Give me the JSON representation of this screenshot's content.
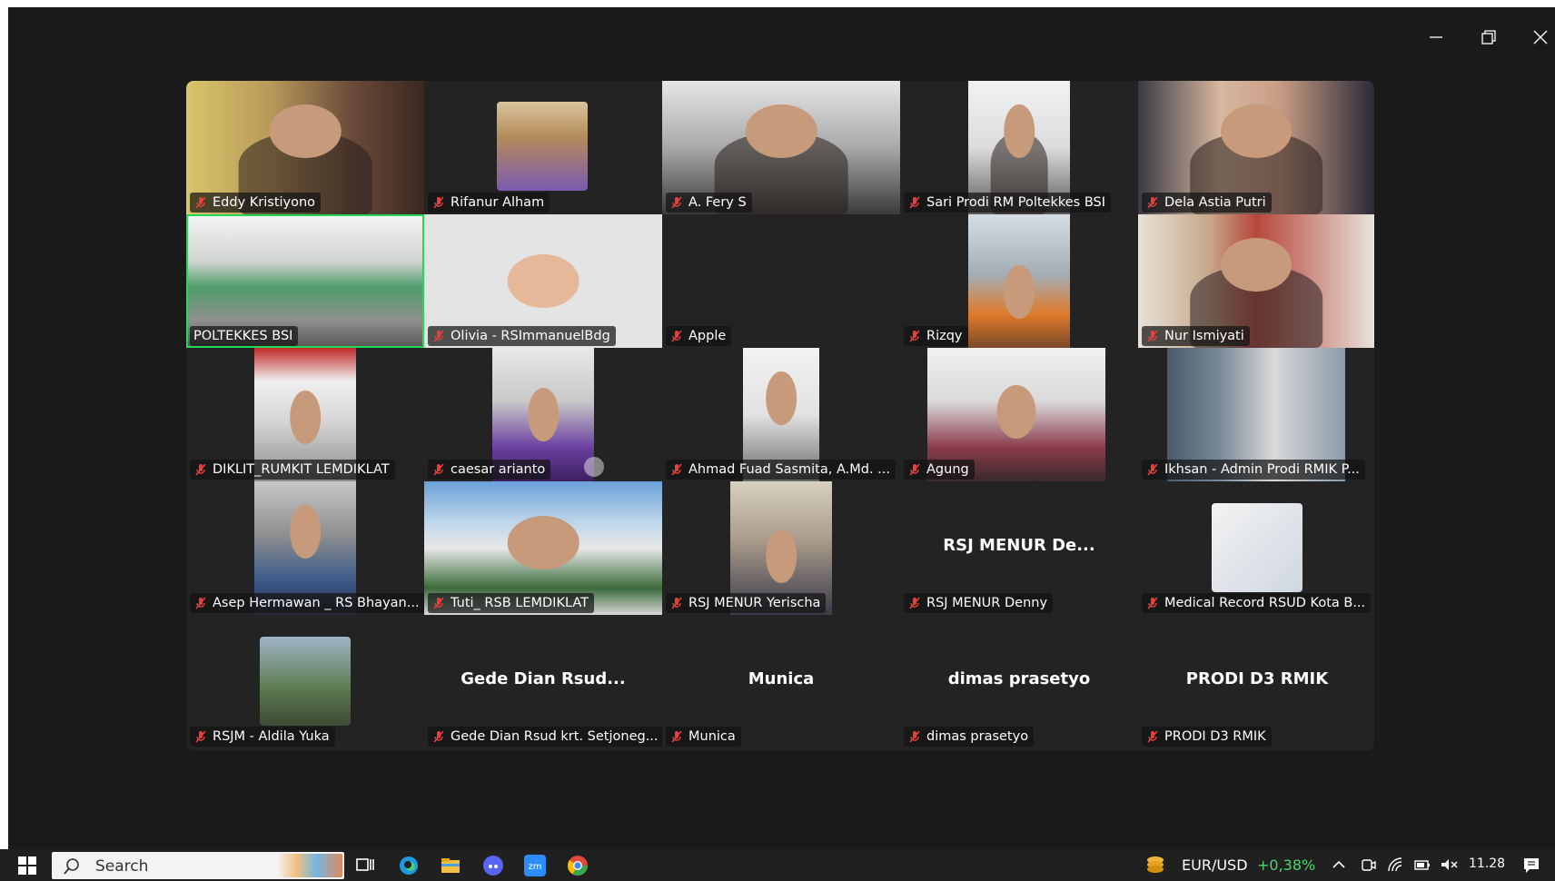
{
  "participants": [
    {
      "name": "Eddy Kristiyono"
    },
    {
      "name": "Rifanur Alham"
    },
    {
      "name": "A. Fery S"
    },
    {
      "name": "Sari Prodi RM Poltekkes BSI"
    },
    {
      "name": "Dela Astia Putri"
    },
    {
      "name": "POLTEKKES BSI"
    },
    {
      "name": "Olivia - RSImmanuelBdg"
    },
    {
      "name": "Apple"
    },
    {
      "name": "Rizqy"
    },
    {
      "name": "Nur Ismiyati"
    },
    {
      "name": "DIKLIT_RUMKIT LEMDIKLAT"
    },
    {
      "name": "caesar arianto"
    },
    {
      "name": "Ahmad Fuad Sasmita, A.Md. ..."
    },
    {
      "name": "Agung"
    },
    {
      "name": "Ikhsan - Admin Prodi RMIK P..."
    },
    {
      "name": "Asep Hermawan _ RS Bhayan..."
    },
    {
      "name": "Tuti_ RSB LEMDIKLAT"
    },
    {
      "name": "RSJ MENUR Yerischa"
    },
    {
      "name": "RSJ MENUR Denny",
      "display": "RSJ MENUR De..."
    },
    {
      "name": "Medical Record RSUD Kota B..."
    },
    {
      "name": "RSJM - Aldila Yuka"
    },
    {
      "name": "Gede Dian Rsud krt. Setjoneg...",
      "display": "Gede Dian Rsud..."
    },
    {
      "name": "Munica",
      "display": "Munica"
    },
    {
      "name": "dimas prasetyo",
      "display": "dimas prasetyo"
    },
    {
      "name": "PRODI D3 RMIK",
      "display": "PRODI D3 RMIK"
    }
  ],
  "taskbar": {
    "search_label": "Search",
    "fx_pair": "EUR/USD",
    "fx_change": "+0,38%",
    "clock": "11.28"
  },
  "colors": {
    "window_bg": "#1a1a1a",
    "tile_bg": "#232323",
    "active_speaker_border": "#23d959",
    "mute_red": "#e5413a",
    "fx_positive": "#4fd371",
    "taskbar_bg": "#202020"
  }
}
